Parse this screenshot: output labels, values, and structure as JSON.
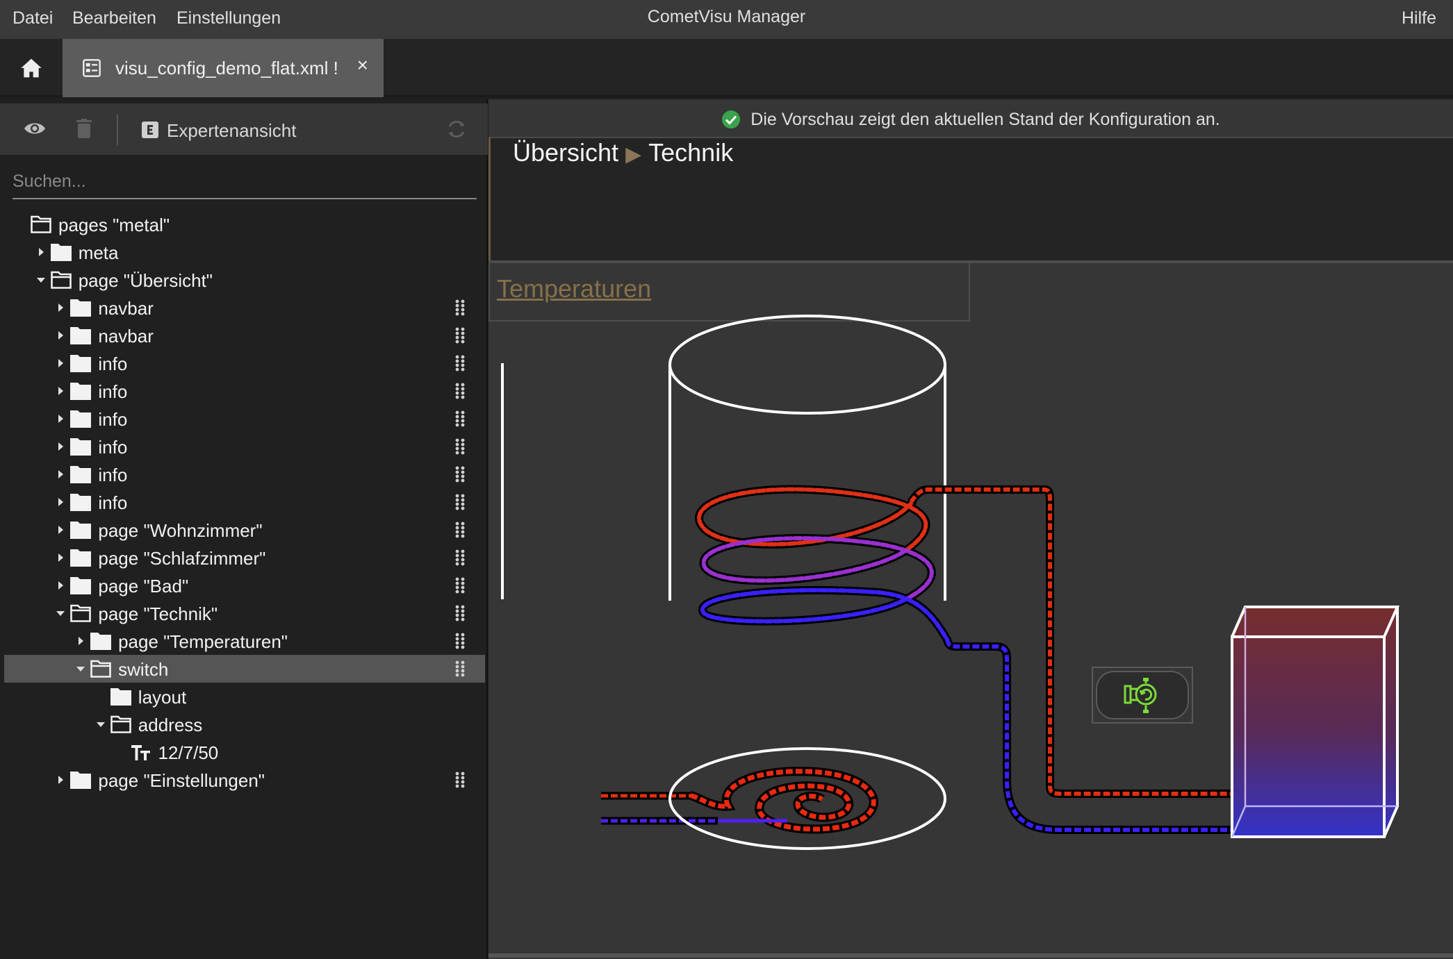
{
  "menubar": {
    "items": [
      "Datei",
      "Bearbeiten",
      "Einstellungen"
    ],
    "title": "CometVisu Manager",
    "help": "Hilfe"
  },
  "tabbar": {
    "file_tab_label": "visu_config_demo_flat.xml !",
    "close_symbol": "×"
  },
  "toolbar": {
    "expert_label": "Expertenansicht"
  },
  "search": {
    "placeholder": "Suchen..."
  },
  "tree": [
    {
      "label": "pages \"metal\"",
      "depth": 0,
      "arrow": "none",
      "icon": "folder-open",
      "grip": false
    },
    {
      "label": "meta",
      "depth": 1,
      "arrow": "right",
      "icon": "folder",
      "grip": false
    },
    {
      "label": "page \"Übersicht\"",
      "depth": 1,
      "arrow": "down",
      "icon": "folder-open",
      "grip": false
    },
    {
      "label": "navbar",
      "depth": 2,
      "arrow": "right",
      "icon": "folder",
      "grip": true
    },
    {
      "label": "navbar",
      "depth": 2,
      "arrow": "right",
      "icon": "folder",
      "grip": true
    },
    {
      "label": "info",
      "depth": 2,
      "arrow": "right",
      "icon": "folder",
      "grip": true
    },
    {
      "label": "info",
      "depth": 2,
      "arrow": "right",
      "icon": "folder",
      "grip": true
    },
    {
      "label": "info",
      "depth": 2,
      "arrow": "right",
      "icon": "folder",
      "grip": true
    },
    {
      "label": "info",
      "depth": 2,
      "arrow": "right",
      "icon": "folder",
      "grip": true
    },
    {
      "label": "info",
      "depth": 2,
      "arrow": "right",
      "icon": "folder",
      "grip": true
    },
    {
      "label": "info",
      "depth": 2,
      "arrow": "right",
      "icon": "folder",
      "grip": true
    },
    {
      "label": "page \"Wohnzimmer\"",
      "depth": 2,
      "arrow": "right",
      "icon": "folder",
      "grip": true
    },
    {
      "label": "page \"Schlafzimmer\"",
      "depth": 2,
      "arrow": "right",
      "icon": "folder",
      "grip": true
    },
    {
      "label": "page \"Bad\"",
      "depth": 2,
      "arrow": "right",
      "icon": "folder",
      "grip": true
    },
    {
      "label": "page \"Technik\"",
      "depth": 2,
      "arrow": "down",
      "icon": "folder-open",
      "grip": true
    },
    {
      "label": "page \"Temperaturen\"",
      "depth": 3,
      "arrow": "right",
      "icon": "folder",
      "grip": true
    },
    {
      "label": "switch",
      "depth": 3,
      "arrow": "down",
      "icon": "folder-open",
      "grip": true,
      "selected": true
    },
    {
      "label": "layout",
      "depth": 4,
      "arrow": "none",
      "icon": "folder",
      "grip": false
    },
    {
      "label": "address",
      "depth": 4,
      "arrow": "down",
      "icon": "folder-open",
      "grip": false
    },
    {
      "label": "12/7/50",
      "depth": 5,
      "arrow": "none",
      "icon": "text",
      "grip": false
    },
    {
      "label": "page \"Einstellungen\"",
      "depth": 2,
      "arrow": "right",
      "icon": "folder",
      "grip": true
    }
  ],
  "preview": {
    "status_text": "Die Vorschau zeigt den aktuellen Stand der Konfiguration an.",
    "breadcrumb_parent": "Übersicht",
    "breadcrumb_sep": "▶",
    "breadcrumb_current": "Technik",
    "temperaturen_link": "Temperaturen"
  },
  "icons": {
    "home": "home-icon",
    "file": "file-config-icon",
    "eye": "eye-icon",
    "trash": "trash-icon",
    "expert": "expert-icon",
    "refresh": "refresh-icon",
    "status": "check-circle-icon",
    "pump": "pump-icon"
  },
  "colors": {
    "status_ok": "#3aa34b",
    "accent_link": "#86704a",
    "pipe_hot": "#e03010",
    "pipe_cold": "#3a20ff",
    "pump_green": "#7cdb3a"
  }
}
